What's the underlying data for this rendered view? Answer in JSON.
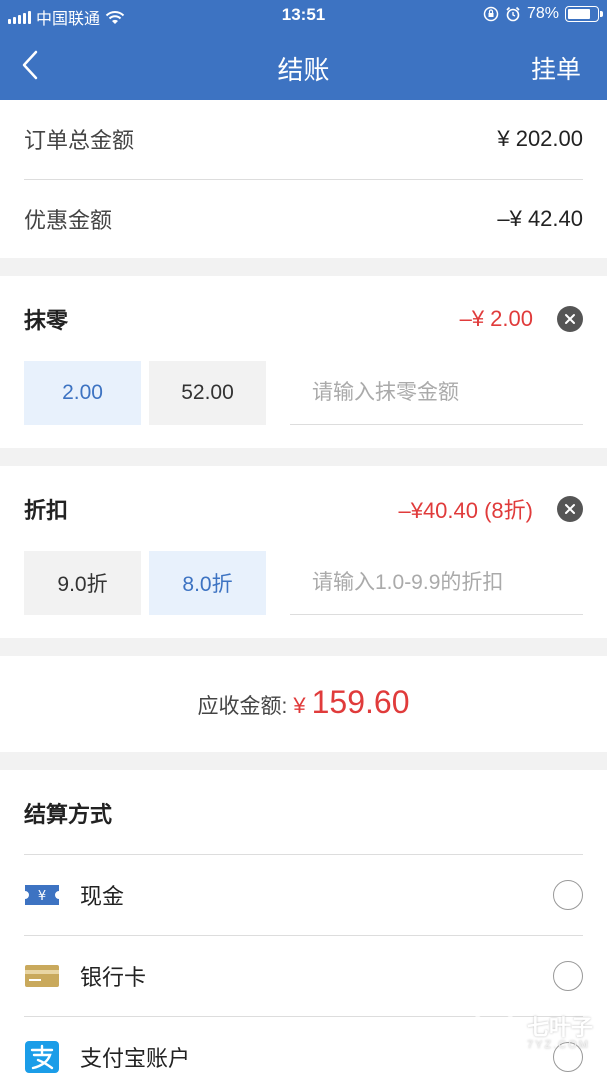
{
  "status_bar": {
    "carrier": "中国联通",
    "time": "13:51",
    "battery": "78%",
    "battery_level": 0.78
  },
  "nav": {
    "title": "结账",
    "right_action": "挂单"
  },
  "summary": {
    "total_label": "订单总金额",
    "total_value": "¥ 202.00",
    "discount_label": "优惠金额",
    "discount_value": "–¥ 42.40"
  },
  "rounding": {
    "title": "抹零",
    "amount": "–¥ 2.00",
    "options": [
      "2.00",
      "52.00"
    ],
    "selected_index": 0,
    "placeholder": "请输入抹零金额"
  },
  "rebate": {
    "title": "折扣",
    "amount": "–¥40.40 (8折)",
    "options": [
      "9.0折",
      "8.0折"
    ],
    "selected_index": 1,
    "placeholder": "请输入1.0-9.9的折扣"
  },
  "due": {
    "label": "应收金额:",
    "currency": "¥",
    "value": "159.60"
  },
  "payment": {
    "title": "结算方式",
    "methods": [
      {
        "label": "现金",
        "icon": "cash-ticket-icon"
      },
      {
        "label": "银行卡",
        "icon": "bank-card-icon"
      },
      {
        "label": "支付宝账户",
        "icon": "alipay-icon"
      }
    ]
  },
  "watermark": {
    "text": "七叶子",
    "sub": "7YZ.COM"
  },
  "colors": {
    "brand": "#3d73c2",
    "accent_red": "#e03b3b",
    "selected_bg": "#e8f1fc"
  }
}
